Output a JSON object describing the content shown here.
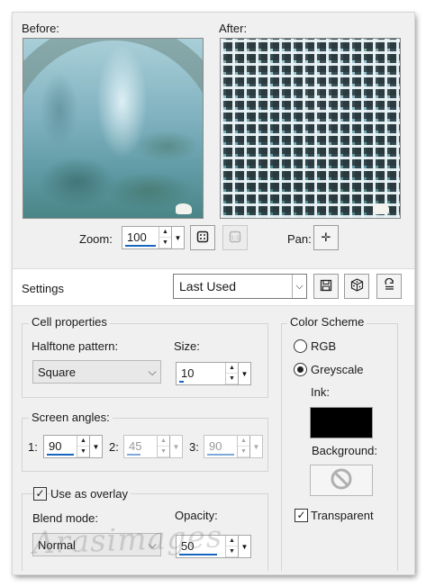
{
  "previews": {
    "before_label": "Before:",
    "after_label": "After:"
  },
  "zoom": {
    "label": "Zoom:",
    "value": "100",
    "pan_label": "Pan:"
  },
  "settings": {
    "label": "Settings",
    "preset": "Last Used"
  },
  "cell_properties": {
    "title": "Cell properties",
    "pattern_label": "Halftone pattern:",
    "pattern_value": "Square",
    "size_label": "Size:",
    "size_value": "10"
  },
  "screen_angles": {
    "title": "Screen angles:",
    "a1_label": "1:",
    "a1_value": "90",
    "a2_label": "2:",
    "a2_value": "45",
    "a3_label": "3:",
    "a3_value": "90"
  },
  "overlay": {
    "checkbox_label": "Use as overlay",
    "checked": true,
    "blend_label": "Blend mode:",
    "blend_value": "Normal",
    "opacity_label": "Opacity:",
    "opacity_value": "50"
  },
  "color_scheme": {
    "title": "Color Scheme",
    "rgb_label": "RGB",
    "greyscale_label": "Greyscale",
    "selected": "Greyscale",
    "ink_label": "Ink:",
    "ink_color": "#000000",
    "background_label": "Background:",
    "transparent_label": "Transparent",
    "transparent_checked": true
  },
  "watermark": "Arasimages",
  "icons": {
    "zoom_fit": "zoom-fit-icon",
    "zoom_actual": "zoom-actual-icon",
    "pan": "pan-icon",
    "save_preset": "save-icon",
    "randomize": "dice-icon",
    "reset": "reset-icon",
    "no_background": "no-color-icon"
  }
}
